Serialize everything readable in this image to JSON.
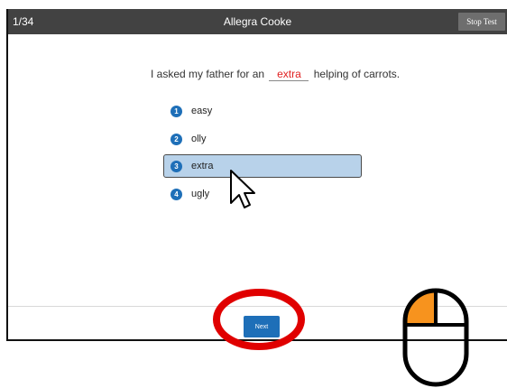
{
  "header": {
    "counter": "1/34",
    "student_name": "Allegra Cooke",
    "stop_label": "Stop Test"
  },
  "question": {
    "before": "I asked my father for an",
    "answer": "extra",
    "after": "helping of carrots."
  },
  "options": [
    {
      "num": "1",
      "label": "easy",
      "selected": false
    },
    {
      "num": "2",
      "label": "olly",
      "selected": false
    },
    {
      "num": "3",
      "label": "extra",
      "selected": true
    },
    {
      "num": "4",
      "label": "ugly",
      "selected": false
    }
  ],
  "footer": {
    "next_label": "Next"
  },
  "colors": {
    "header_bg": "#424242",
    "selected_bg": "#b8d2ea",
    "badge": "#1e6fb8",
    "answer_text": "#e02020",
    "annotation_circle": "#e00000",
    "mouse_left_button": "#f7931e"
  },
  "overlay_icons": [
    "mouse-pointer-icon",
    "red-highlight-circle",
    "mouse-left-click-icon"
  ]
}
